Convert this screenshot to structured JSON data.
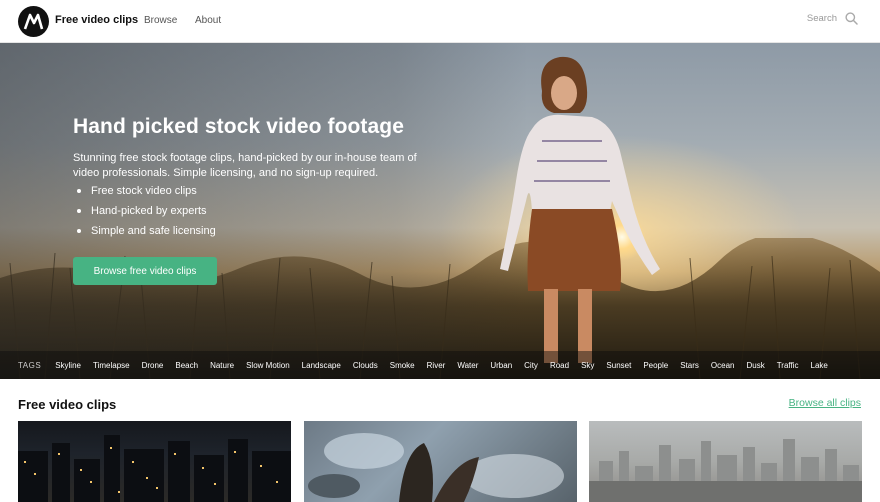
{
  "nav": {
    "brand": "Free video clips",
    "links": [
      "Browse",
      "About"
    ],
    "search_label": "Search"
  },
  "hero": {
    "title": "Hand picked stock video footage",
    "subtitle": "Stunning free stock footage clips, hand-picked by our in-house team of video professionals. Simple licensing, and no sign-up required.",
    "bullets": [
      "Free stock video clips",
      "Hand-picked by experts",
      "Simple and safe licensing"
    ],
    "cta_label": "Browse free video clips"
  },
  "tags": {
    "label": "TAGS",
    "items": [
      "Skyline",
      "Timelapse",
      "Drone",
      "Beach",
      "Nature",
      "Slow Motion",
      "Landscape",
      "Clouds",
      "Smoke",
      "River",
      "Water",
      "Urban",
      "City",
      "Road",
      "Sky",
      "Sunset",
      "People",
      "Stars",
      "Ocean",
      "Dusk",
      "Traffic",
      "Lake"
    ]
  },
  "section": {
    "title": "Free video clips",
    "browse_all": "Browse all clips"
  },
  "colors": {
    "accent": "#47b383",
    "logo_bg": "#111111"
  }
}
